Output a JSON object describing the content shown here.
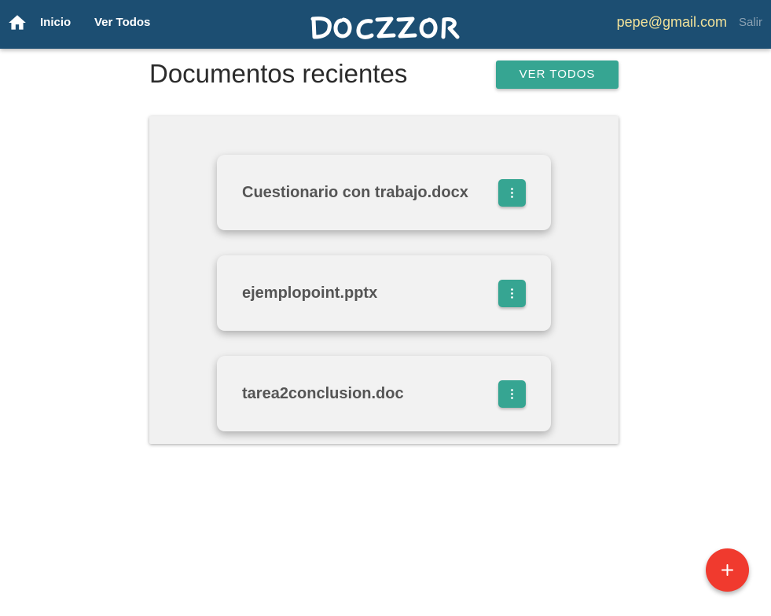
{
  "navbar": {
    "home_icon": "home-icon",
    "links": [
      {
        "label": "Inicio"
      },
      {
        "label": "Ver Todos"
      }
    ],
    "brand": "DOCZZOR",
    "user_email": "pepe@gmail.com",
    "logout_label": "Salir"
  },
  "main": {
    "title": "Documentos recientes",
    "view_all_label": "VER TODOS",
    "documents": [
      {
        "name": "Cuestionario con trabajo.docx",
        "menu_icon": "more-vert-icon"
      },
      {
        "name": "ejemplopoint.pptx",
        "menu_icon": "more-vert-icon"
      },
      {
        "name": "tarea2conclusion.doc",
        "menu_icon": "more-vert-icon"
      }
    ]
  },
  "fab": {
    "icon": "plus-icon"
  },
  "colors": {
    "navbar": "#1c4e72",
    "accent_teal": "#36a592",
    "email": "#f2e29a",
    "fab": "#f03a2e"
  }
}
